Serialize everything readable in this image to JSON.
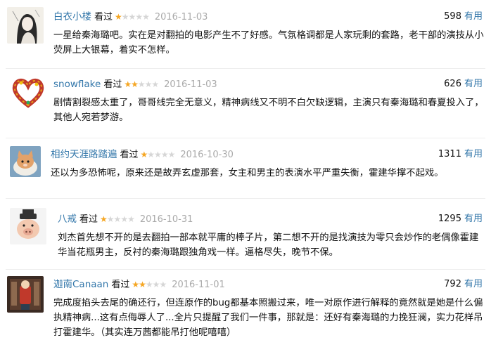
{
  "reviews": [
    {
      "user": "白衣小楼",
      "action": "看过",
      "rating": 1,
      "date": "2016-11-03",
      "votes": "598",
      "useful": "有用",
      "text": "一星给秦海璐吧。实在是对翻拍的电影产生不了好感。气氛格调都是人家玩剩的套路，老干部的演技从小荧屏上大银幕，着实不怎样。",
      "avatar": "ink-portrait-avatar"
    },
    {
      "user": "snowflake",
      "action": "看过",
      "rating": 2,
      "date": "2016-11-03",
      "votes": "626",
      "useful": "有用",
      "text": "剧情割裂感太重了，哥哥线完全无意义，精神病线又不明不白欠缺逻辑，主演只有秦海璐和春夏投入了，其他人宛若梦游。",
      "avatar": "heart-wreath-avatar"
    },
    {
      "user": "相约天涯路踏遍",
      "action": "看过",
      "rating": 1,
      "date": "2016-10-30",
      "votes": "1311",
      "useful": "有用",
      "text": "还以为多恐怖呢，原来还是故弄玄虚那套，女主和男主的表演水平严重失衡，霍建华撑不起戏。",
      "avatar": "cat-avatar"
    },
    {
      "user": "八戒",
      "action": "看过",
      "rating": 1,
      "date": "2016-10-31",
      "votes": "1295",
      "useful": "有用",
      "text": "刘杰首先想不开的是去翻拍一部本就平庸的棒子片，第二想不开的是找演技为零只会炒作的老偶像霍建华当花瓶男主，反衬的秦海璐跟独角戏一样。逼格尽失，晚节不保。",
      "avatar": "pig-figure-avatar"
    },
    {
      "user": "迦南Canaan",
      "action": "看过",
      "rating": 2,
      "date": "2016-11-01",
      "votes": "792",
      "useful": "有用",
      "text": "完成度掐头去尾的确还行，但连原作的bug都基本照搬过来，唯一对原作进行解释的竟然就是她是什么偏执精神病...这有点侮辱人了...全片只提醒了我们一件事，那就是：还好有秦海璐的力挽狂澜，实力花样吊打霍建华。（其实连万茜都能吊打他呢嘻嘻）",
      "avatar": "figurine-avatar"
    }
  ],
  "colors": {
    "link": "#3377aa",
    "star_on": "#f5a623",
    "star_off": "#d6d6d6",
    "date": "#aaaaaa"
  }
}
